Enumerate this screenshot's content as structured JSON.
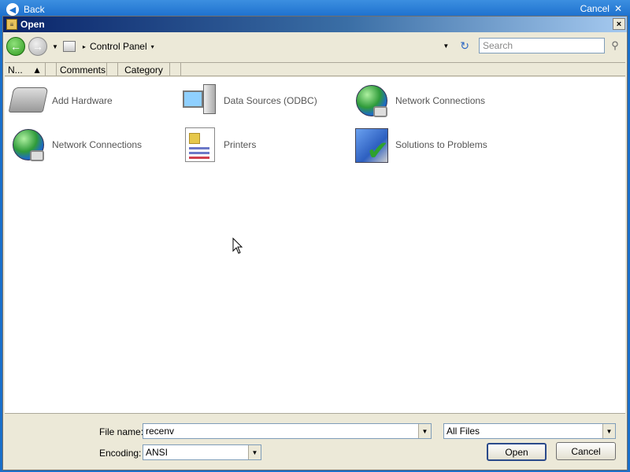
{
  "background": {
    "back_label": "Back",
    "cancel_label": "Cancel"
  },
  "dialog": {
    "title": "Open",
    "close_glyph": "×"
  },
  "navbar": {
    "breadcrumb": "Control Panel",
    "search_placeholder": "Search"
  },
  "columns": [
    {
      "label": "N..."
    },
    {
      "label": "Comments"
    },
    {
      "label": "Category"
    }
  ],
  "items": [
    {
      "label": "Add Hardware",
      "icon": "hardware-icon"
    },
    {
      "label": "Data Sources (ODBC)",
      "icon": "odbc-icon"
    },
    {
      "label": "Network Connections",
      "icon": "globe-network-icon"
    },
    {
      "label": "Network Connections",
      "icon": "globe-network-icon"
    },
    {
      "label": "Printers",
      "icon": "printers-icon"
    },
    {
      "label": "Solutions to Problems",
      "icon": "solutions-icon"
    }
  ],
  "bottom": {
    "filename_label": "File name:",
    "filename_value": "recenv",
    "filetype_value": "All Files",
    "encoding_label": "Encoding:",
    "encoding_value": "ANSI",
    "open_label": "Open",
    "cancel_label": "Cancel"
  },
  "colors": {
    "title_gradient_start": "#0a246a",
    "dialog_bg": "#ece9d8",
    "content_bg": "#ffffff"
  }
}
